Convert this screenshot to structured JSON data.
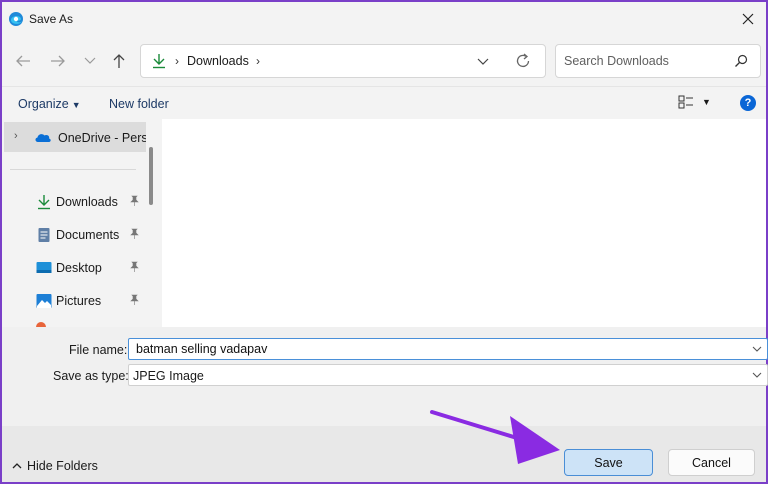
{
  "window": {
    "title": "Save As",
    "icon": "edge-browser-icon",
    "close_icon": "close-icon"
  },
  "nav_buttons": {
    "back": "back-arrow-icon",
    "forward": "forward-arrow-icon",
    "recent": "chevron-down-icon",
    "up": "up-arrow-icon"
  },
  "address_bar": {
    "location_icon": "download-icon",
    "path": "Downloads",
    "separator": "›"
  },
  "search": {
    "placeholder": "Search Downloads"
  },
  "toolbar": {
    "organize_label": "Organize",
    "new_folder_label": "New folder",
    "view_icon": "view-options-icon",
    "help_icon": "help-icon",
    "help_glyph": "?"
  },
  "nav_pane": {
    "onedrive_label": "OneDrive - Perso",
    "quick_access": [
      {
        "label": "Downloads",
        "icon": "download-icon"
      },
      {
        "label": "Documents",
        "icon": "documents-icon"
      },
      {
        "label": "Desktop",
        "icon": "desktop-icon"
      },
      {
        "label": "Pictures",
        "icon": "pictures-icon"
      }
    ]
  },
  "form": {
    "file_name_label": "File name:",
    "file_name_value": "batman selling vadapav",
    "save_type_label": "Save as type:",
    "save_type_value": "JPEG Image"
  },
  "footer": {
    "hide_folders_label": "Hide Folders",
    "save_label": "Save",
    "cancel_label": "Cancel"
  },
  "colors": {
    "accent": "#0a66d6",
    "border": "#7a3fc8",
    "annotation_arrow": "#8a2be2"
  }
}
